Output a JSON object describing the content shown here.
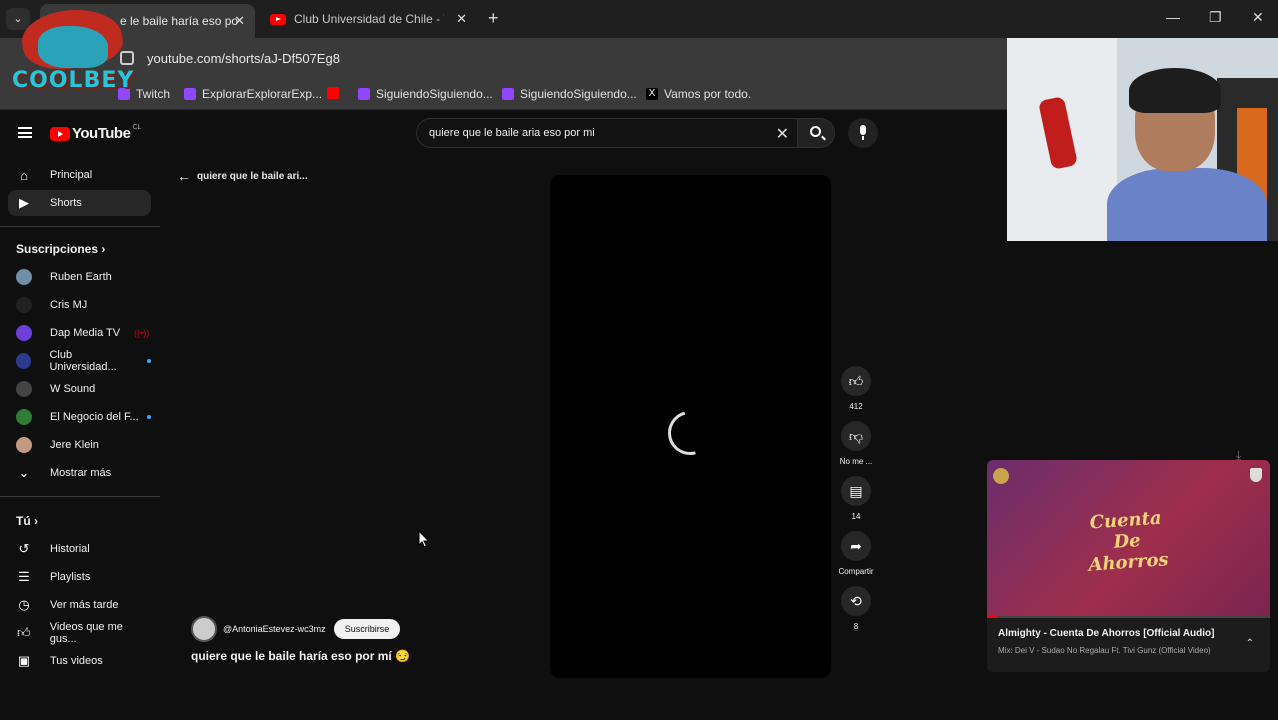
{
  "browser": {
    "tabs": [
      {
        "title": "e le baile haría eso po",
        "active": true
      },
      {
        "title": "Club Universidad de Chile - You",
        "active": false
      }
    ],
    "url": "youtube.com/shorts/aJ-Df507Eg8",
    "bookmarks": [
      {
        "label": "Twitch",
        "icon": "twitch-icon"
      },
      {
        "label": "ExplorarExplorarExp...",
        "icon": "twitch-icon"
      },
      {
        "label": "",
        "icon": "youtube-icon"
      },
      {
        "label": "SiguiendoSiguiendo...",
        "icon": "twitch-icon"
      },
      {
        "label": "SiguiendoSiguiendo...",
        "icon": "twitch-icon"
      },
      {
        "label": "Vamos por todo.",
        "icon": "x-icon"
      }
    ]
  },
  "overlay_logo": {
    "text": "COOLBEY"
  },
  "header": {
    "logo": "YouTube",
    "country": "CL",
    "search_query": "quiere que le baile aria eso por mi"
  },
  "sidebar": {
    "main": [
      {
        "label": "Principal",
        "icon": "home-icon"
      },
      {
        "label": "Shorts",
        "icon": "shorts-icon",
        "selected": true
      }
    ],
    "subscriptions_title": "Suscripciones",
    "subscriptions": [
      {
        "label": "Ruben Earth",
        "avatar_color": "#6f8fa8"
      },
      {
        "label": "Cris MJ",
        "avatar_color": "#222222"
      },
      {
        "label": "Dap Media TV",
        "avatar_color": "#6b3fd8",
        "live": true
      },
      {
        "label": "Club Universidad...",
        "avatar_color": "#2b3a8c",
        "new": true
      },
      {
        "label": "W Sound",
        "avatar_color": "#444444"
      },
      {
        "label": "El Negocio del F...",
        "avatar_color": "#2f7d32",
        "new": true
      },
      {
        "label": "Jere Klein",
        "avatar_color": "#c29a80"
      }
    ],
    "show_more": "Mostrar más",
    "you_title": "Tú",
    "you": [
      {
        "label": "Historial",
        "icon": "history-icon"
      },
      {
        "label": "Playlists",
        "icon": "playlists-icon"
      },
      {
        "label": "Ver más tarde",
        "icon": "clock-icon"
      },
      {
        "label": "Videos que me gus...",
        "icon": "like-icon"
      },
      {
        "label": "Tus videos",
        "icon": "your-videos-icon"
      }
    ]
  },
  "short": {
    "back_label": "quiere que le baile ari...",
    "channel": "@AntoniaEstevez-wc3mz",
    "subscribe": "Suscribirse",
    "title": "quiere que le baile haría eso por mí 😏",
    "actions": {
      "likes": "412",
      "dislike": "No me ...",
      "comments": "14",
      "share": "Compartir",
      "remix": "8"
    }
  },
  "mini_player": {
    "cover_text_1": "Cuenta",
    "cover_text_2": "De",
    "cover_text_3": "Ahorros",
    "title": "Almighty - Cuenta De Ahorros [Official Audio]",
    "subtitle": "Mix: Dei V - Sudao No Regalau Ft. Tivi Gunz (Official Video)",
    "progress": 0.04
  }
}
